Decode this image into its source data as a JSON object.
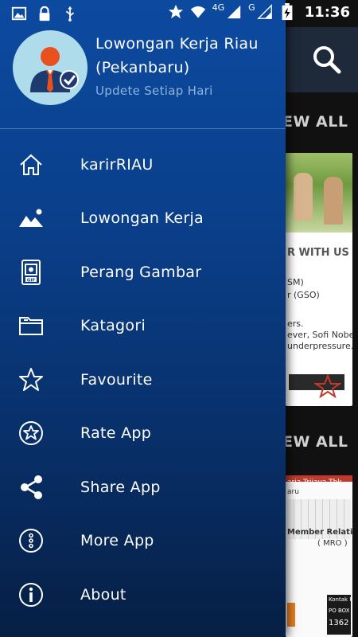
{
  "status_bar": {
    "network_type": "4G",
    "network_type_2": "G",
    "time": "11:36"
  },
  "drawer": {
    "app_title": "Lowongan Kerja Riau (Pekanbaru)",
    "subtitle": "Updete Setiap Hari",
    "menu": [
      {
        "label": "karirRIAU",
        "icon": "home-icon"
      },
      {
        "label": "Lowongan Kerja",
        "icon": "image-icon"
      },
      {
        "label": "Perang Gambar",
        "icon": "gif-file-icon"
      },
      {
        "label": "Katagori",
        "icon": "folder-icon"
      },
      {
        "label": "Favourite",
        "icon": "star-icon"
      },
      {
        "label": "Rate App",
        "icon": "star-circle-icon"
      },
      {
        "label": "Share App",
        "icon": "share-icon"
      },
      {
        "label": "More App",
        "icon": "more-vertical-icon"
      },
      {
        "label": "About",
        "icon": "info-icon"
      }
    ]
  },
  "background": {
    "section_1_action": "EW ALL",
    "section_2_action": "EW ALL",
    "thumb_1_lines": [
      "R WITH US",
      "SM)",
      "r (GSO)",
      "ers.",
      "ever, Sofi Nobels.",
      "underpressure."
    ],
    "thumb_2_lines": [
      "aria Trijaya Tbk",
      "aru",
      "Member Relation Officer",
      "( MRO )",
      "Kontak Pos",
      "PO BOX",
      "1362"
    ]
  },
  "colors": {
    "drawer_top": "#0c4aa0",
    "drawer_bottom": "#061f44",
    "subtitle": "#8fb3d9",
    "avatar_bg": "#aedcea"
  }
}
